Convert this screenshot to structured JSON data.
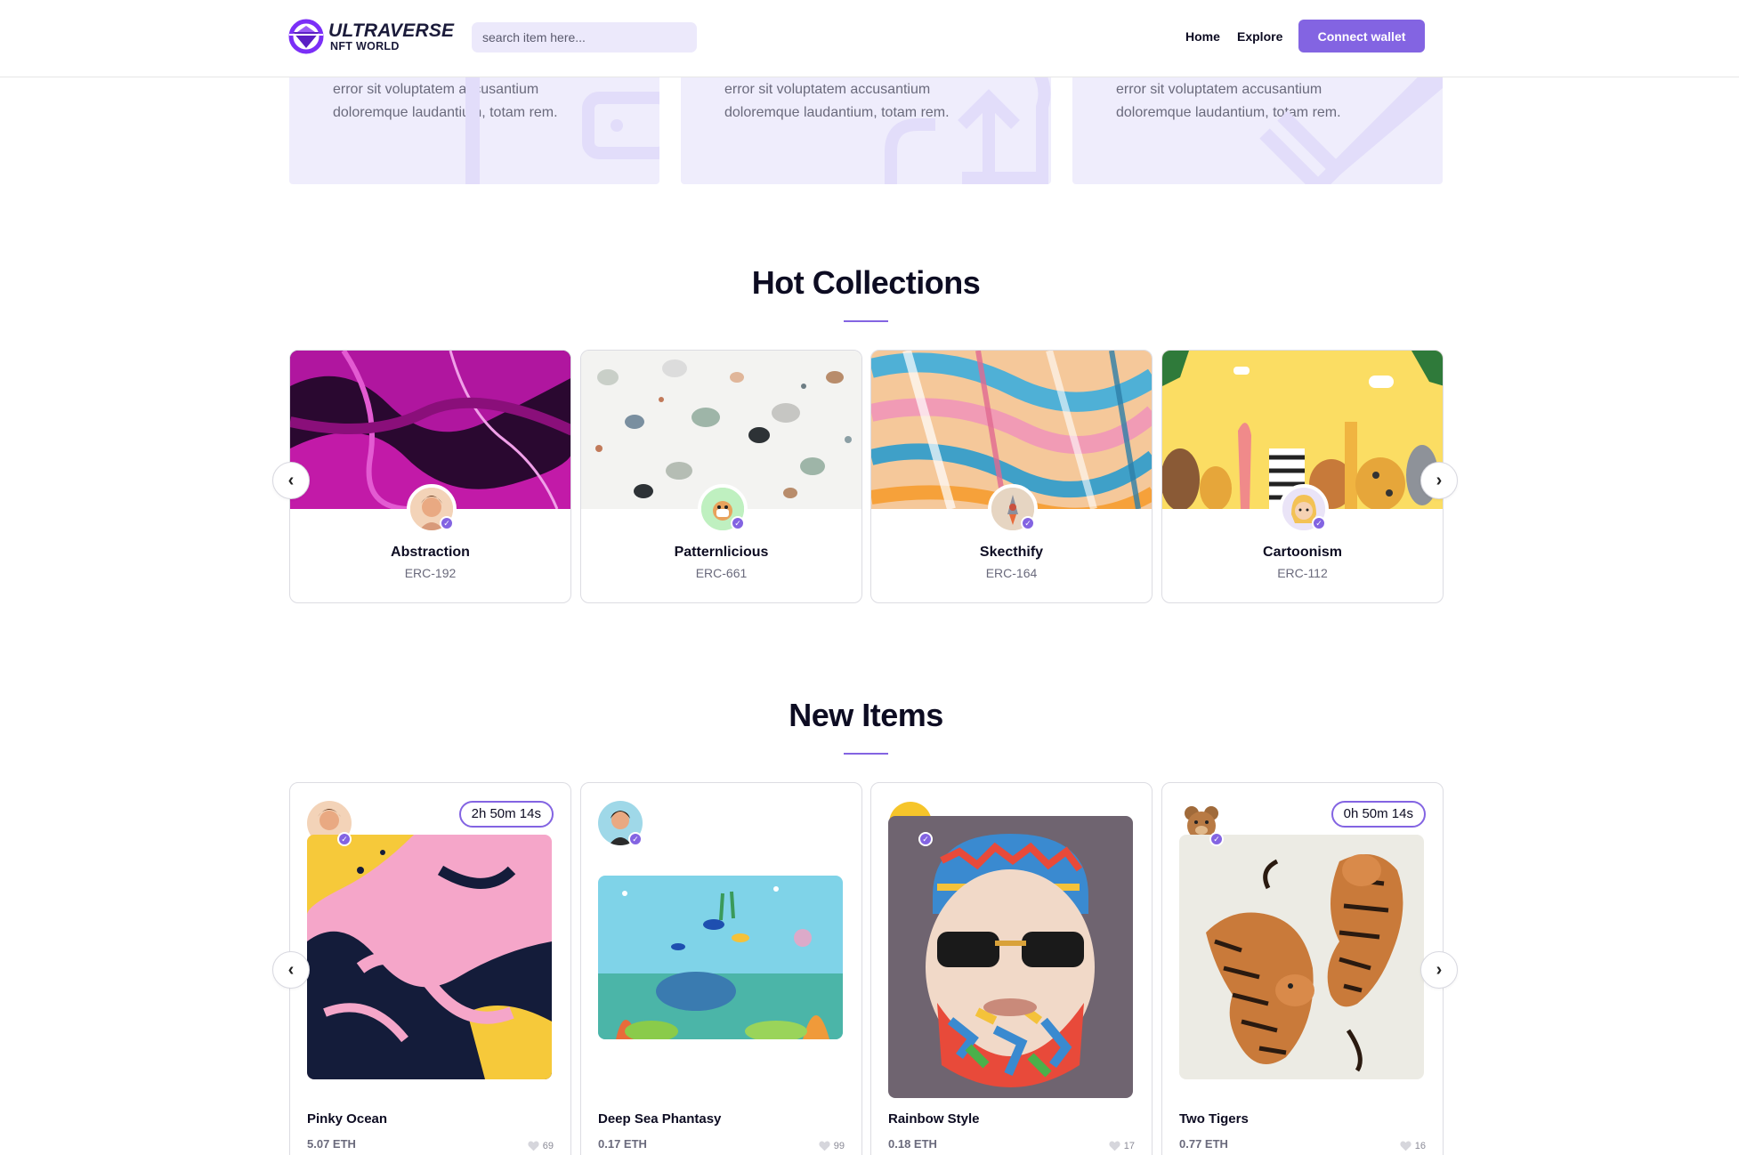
{
  "header": {
    "logo_line1": "ULTRAVERSE",
    "logo_line2": "NFT WORLD",
    "search_placeholder": "search item here...",
    "nav": [
      "Home",
      "Explore"
    ],
    "connect_label": "Connect wallet"
  },
  "features": [
    {
      "text": "error sit voluptatem accusantium doloremque laudantium, totam rem.",
      "icon": "wallet-icon"
    },
    {
      "text": "error sit voluptatem accusantium doloremque laudantium, totam rem.",
      "icon": "upload-icon"
    },
    {
      "text": "error sit voluptatem accusantium doloremque laudantium, totam rem.",
      "icon": "tag-icon"
    }
  ],
  "hot_collections": {
    "title": "Hot Collections",
    "prev_label": "‹",
    "next_label": "›",
    "items": [
      {
        "name": "Abstraction",
        "code": "ERC-192"
      },
      {
        "name": "Patternlicious",
        "code": "ERC-661"
      },
      {
        "name": "Skecthify",
        "code": "ERC-164"
      },
      {
        "name": "Cartoonism",
        "code": "ERC-112"
      }
    ]
  },
  "new_items": {
    "title": "New Items",
    "prev_label": "‹",
    "next_label": "›",
    "items": [
      {
        "title": "Pinky Ocean",
        "price": "5.07 ETH",
        "likes": "69",
        "timer": "2h 50m 14s"
      },
      {
        "title": "Deep Sea Phantasy",
        "price": "0.17 ETH",
        "likes": "99",
        "timer": ""
      },
      {
        "title": "Rainbow Style",
        "price": "0.18 ETH",
        "likes": "17",
        "timer": ""
      },
      {
        "title": "Two Tigers",
        "price": "0.77 ETH",
        "likes": "16",
        "timer": "0h 50m 14s"
      }
    ]
  },
  "colors": {
    "accent": "#8364e2",
    "feature_bg": "#efedfc",
    "search_bg": "#ece9fb"
  }
}
